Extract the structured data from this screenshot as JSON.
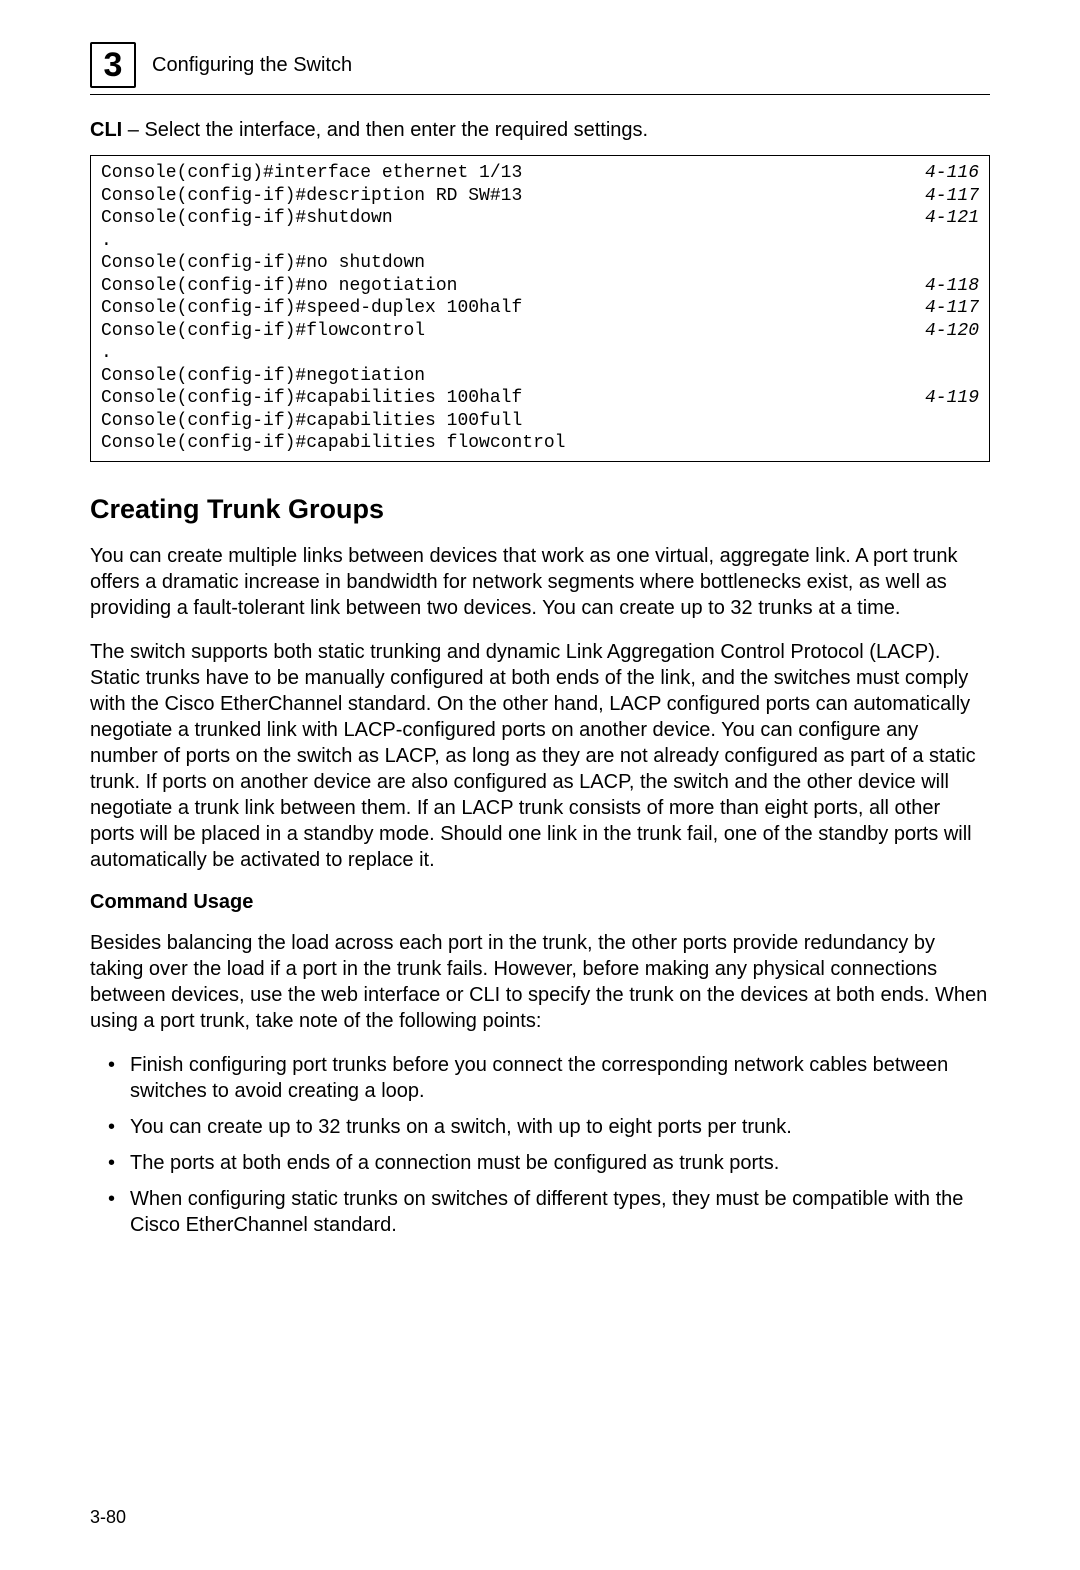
{
  "header": {
    "chapter_number": "3",
    "chapter_title": "Configuring the Switch"
  },
  "lead": {
    "bold": "CLI",
    "rest": " – Select the interface, and then enter the required settings."
  },
  "cli": [
    {
      "cmd": "Console(config)#interface ethernet 1/13",
      "ref": "4-116"
    },
    {
      "cmd": "Console(config-if)#description RD SW#13",
      "ref": "4-117"
    },
    {
      "cmd": "Console(config-if)#shutdown",
      "ref": "4-121"
    },
    {
      "cmd": ".",
      "ref": ""
    },
    {
      "cmd": "Console(config-if)#no shutdown",
      "ref": ""
    },
    {
      "cmd": "Console(config-if)#no negotiation",
      "ref": "4-118"
    },
    {
      "cmd": "Console(config-if)#speed-duplex 100half",
      "ref": "4-117"
    },
    {
      "cmd": "Console(config-if)#flowcontrol",
      "ref": "4-120"
    },
    {
      "cmd": ".",
      "ref": ""
    },
    {
      "cmd": "Console(config-if)#negotiation",
      "ref": ""
    },
    {
      "cmd": "Console(config-if)#capabilities 100half",
      "ref": "4-119"
    },
    {
      "cmd": "Console(config-if)#capabilities 100full",
      "ref": ""
    },
    {
      "cmd": "Console(config-if)#capabilities flowcontrol",
      "ref": ""
    }
  ],
  "section_heading": "Creating Trunk Groups",
  "para1": "You can create multiple links between devices that work as one virtual, aggregate link. A port trunk offers a dramatic increase in bandwidth for network segments where bottlenecks exist, as well as providing a fault-tolerant link between two devices. You can create up to 32 trunks at a time.",
  "para2": "The switch supports both static trunking and dynamic Link Aggregation Control Protocol (LACP). Static trunks have to be manually configured at both ends of the link, and the switches must comply with the Cisco EtherChannel standard. On the other hand, LACP configured ports can automatically negotiate a trunked link with LACP-configured ports on another device. You can configure any number of ports on the switch as LACP, as long as they are not already configured as part of a static trunk. If ports on another device are also configured as LACP, the switch and the other device will negotiate a trunk link between them. If an LACP trunk consists of more than eight ports, all other ports will be placed in a standby mode. Should one link in the trunk fail, one of the standby ports will automatically be activated to replace it.",
  "subheading": "Command Usage",
  "para3": "Besides balancing the load across each port in the trunk, the other ports provide redundancy by taking over the load if a port in the trunk fails. However, before making any physical connections between devices, use the web interface or CLI to specify the trunk on the devices at both ends. When using a port trunk, take note of the following points:",
  "bullets": [
    "Finish configuring port trunks before you connect the corresponding network cables between switches to avoid creating a loop.",
    "You can create up to 32 trunks on a switch, with up to eight ports per trunk.",
    "The ports at both ends of a connection must be configured as trunk ports.",
    "When configuring static trunks on switches of different types, they must be compatible with the Cisco EtherChannel standard."
  ],
  "footer": "3-80"
}
